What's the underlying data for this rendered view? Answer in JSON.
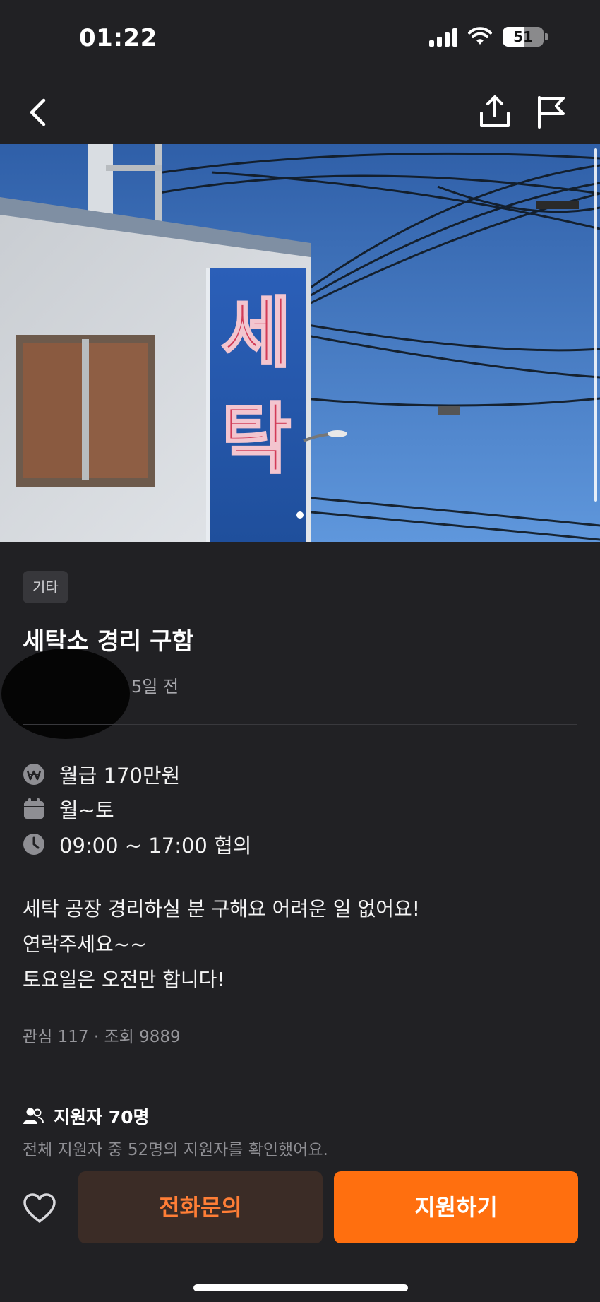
{
  "status_bar": {
    "time": "01:22",
    "battery_level": "51"
  },
  "nav": {
    "icons": [
      "back-arrow-icon",
      "share-icon",
      "report-flag-icon"
    ]
  },
  "hero": {
    "sign_char_1": "세",
    "sign_char_2": "탁",
    "current_page": 1
  },
  "post": {
    "category": "기타",
    "title": "세탁소 경리 구함",
    "time_ago": "5일 전",
    "salary": "월급 170만원",
    "days": "월~토",
    "hours": "09:00 ~ 17:00 협의",
    "description_lines": [
      "세탁 공장 경리하실 분 구해요 어려운 일 없어요!",
      "연락주세요~~",
      "토요일은 오전만 합니다!"
    ],
    "stats": "관심 117 · 조회 9889"
  },
  "applicants": {
    "title": "지원자 70명",
    "subtitle": "전체 지원자 중 52명의 지원자를 확인했어요."
  },
  "actions": {
    "call_label": "전화문의",
    "apply_label": "지원하기"
  },
  "colors": {
    "background": "#212124",
    "accent": "#ff6f0f",
    "call_text": "#ff7e36",
    "call_bg": "#3b2c26"
  }
}
